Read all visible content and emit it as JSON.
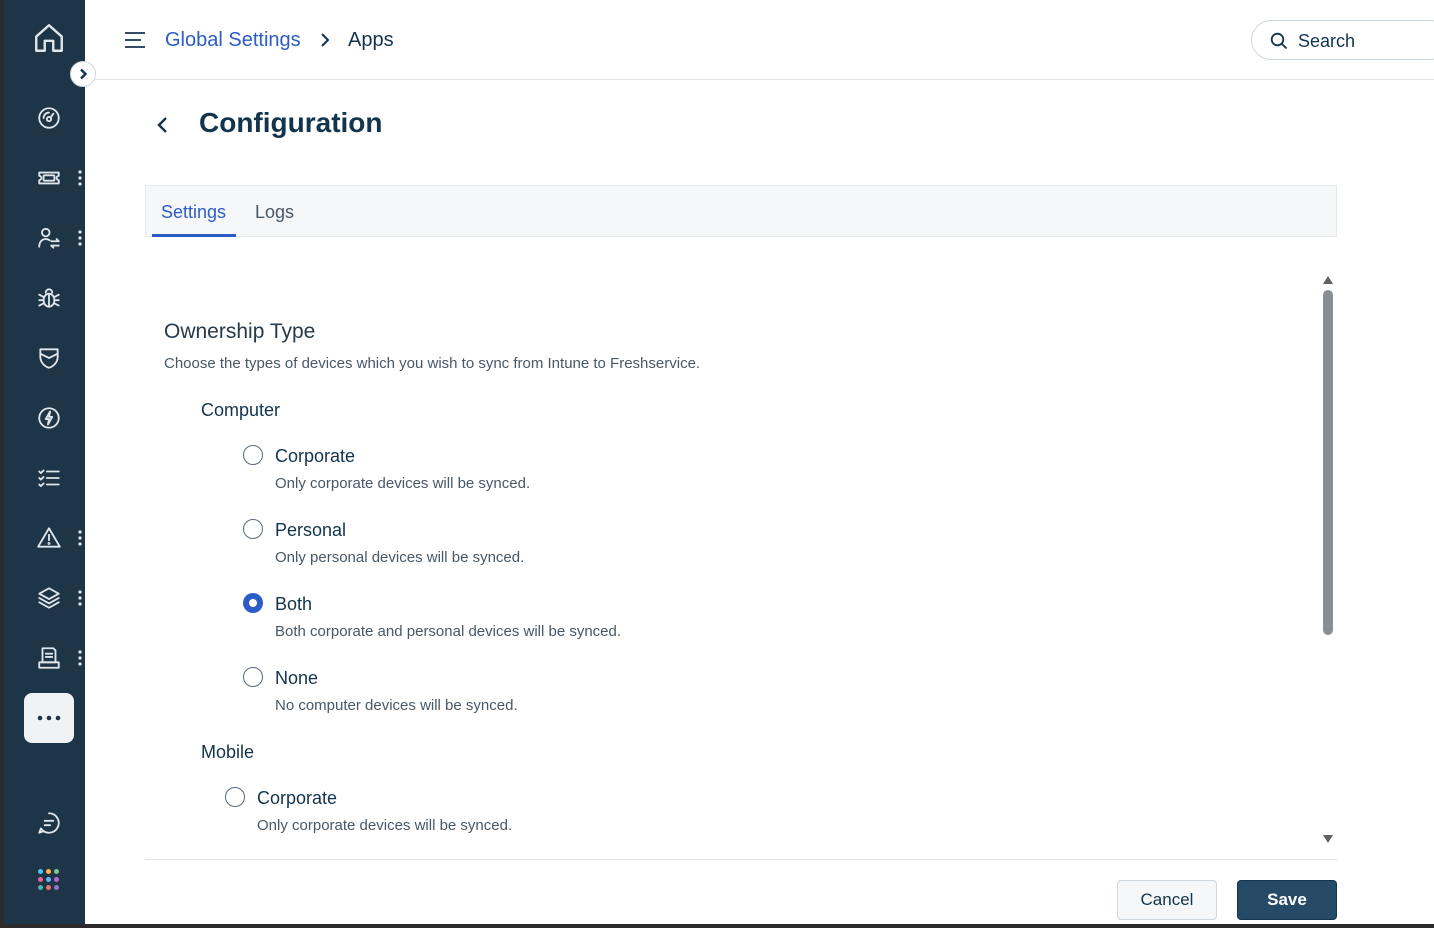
{
  "sidebar": {
    "items": [
      {
        "icon": "home-icon"
      },
      {
        "icon": "dashboard-icon"
      },
      {
        "icon": "ticket-icon",
        "has_menu": true
      },
      {
        "icon": "user-switch-icon",
        "has_menu": true
      },
      {
        "icon": "bug-icon"
      },
      {
        "icon": "shield-icon"
      },
      {
        "icon": "lightning-icon"
      },
      {
        "icon": "checklist-icon"
      },
      {
        "icon": "warning-icon",
        "has_menu": true
      },
      {
        "icon": "layers-icon",
        "has_menu": true
      },
      {
        "icon": "document-icon",
        "has_menu": true
      },
      {
        "icon": "more-icon",
        "active": true
      },
      {
        "icon": "chat-icon"
      },
      {
        "icon": "apps-grid-icon"
      }
    ],
    "accent_active_bg": "#f0f3f6",
    "background": "#1e3447"
  },
  "header": {
    "breadcrumb_link": "Global Settings",
    "breadcrumb_current": "Apps",
    "search_placeholder": "Search"
  },
  "page": {
    "title": "Configuration"
  },
  "tabs": [
    {
      "label": "Settings",
      "active": true
    },
    {
      "label": "Logs",
      "active": false
    }
  ],
  "ownership": {
    "title": "Ownership Type",
    "description": "Choose the types of devices which you wish to sync from Intune to Freshservice.",
    "computer": {
      "title": "Computer",
      "options": [
        {
          "label": "Corporate",
          "description": "Only corporate devices will be synced.",
          "selected": false
        },
        {
          "label": "Personal",
          "description": "Only personal devices will be synced.",
          "selected": false
        },
        {
          "label": "Both",
          "description": "Both corporate and personal devices will be synced.",
          "selected": true
        },
        {
          "label": "None",
          "description": "No computer devices will be synced.",
          "selected": false
        }
      ]
    },
    "mobile": {
      "title": "Mobile",
      "options": [
        {
          "label": "Corporate",
          "description": "Only corporate devices will be synced.",
          "selected": false
        }
      ]
    }
  },
  "footer": {
    "cancel_label": "Cancel",
    "save_label": "Save"
  },
  "colors": {
    "accent": "#2c5cc5",
    "primary_button": "#264966",
    "text": "#12344d"
  }
}
